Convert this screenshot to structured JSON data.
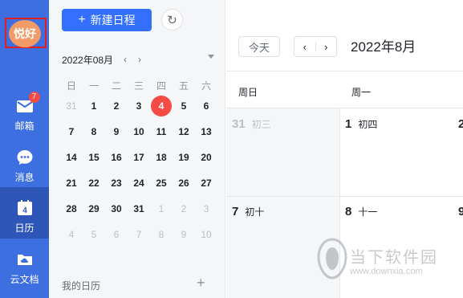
{
  "rail": {
    "avatar_text": "悦好",
    "items": [
      {
        "label": "邮箱",
        "icon": "mail-icon",
        "badge": "7",
        "active": false
      },
      {
        "label": "消息",
        "icon": "chat-icon",
        "active": false
      },
      {
        "label": "日历",
        "icon": "calendar-icon",
        "day": "4",
        "active": true
      },
      {
        "label": "云文档",
        "icon": "cloud-folder-icon",
        "active": false
      }
    ]
  },
  "panel": {
    "new_event_label": "新建日程",
    "month_title": "2022年08月",
    "weekdays": [
      "日",
      "一",
      "二",
      "三",
      "四",
      "五",
      "六"
    ],
    "weeks": [
      [
        "31",
        "1",
        "2",
        "3",
        "4",
        "5",
        "6"
      ],
      [
        "7",
        "8",
        "9",
        "10",
        "11",
        "12",
        "13"
      ],
      [
        "14",
        "15",
        "16",
        "17",
        "18",
        "19",
        "20"
      ],
      [
        "21",
        "22",
        "23",
        "24",
        "25",
        "26",
        "27"
      ],
      [
        "28",
        "29",
        "30",
        "31",
        "1",
        "2",
        "3"
      ],
      [
        "4",
        "5",
        "6",
        "7",
        "8",
        "9",
        "10"
      ]
    ],
    "today": "4",
    "my_calendars_label": "我的日历"
  },
  "main": {
    "today_button": "今天",
    "current_month": "2022年8月",
    "weekday_headers": [
      "周日",
      "周一"
    ],
    "days": [
      {
        "num": "31",
        "lunar": "初三",
        "muted": true
      },
      {
        "num": "1",
        "lunar": "初四"
      },
      {
        "num": "2",
        "lunar": ""
      },
      {
        "num": "7",
        "lunar": "初十"
      },
      {
        "num": "8",
        "lunar": "十一"
      },
      {
        "num": "9",
        "lunar": ""
      }
    ]
  },
  "colors": {
    "rail": "#3d6fe0",
    "rail_active": "#2d56b8",
    "primary": "#3370ff",
    "today": "#f54a45",
    "avatar": "#f29b67"
  },
  "watermark": {
    "text": "当下软件园",
    "url": "www.downxia.com"
  }
}
